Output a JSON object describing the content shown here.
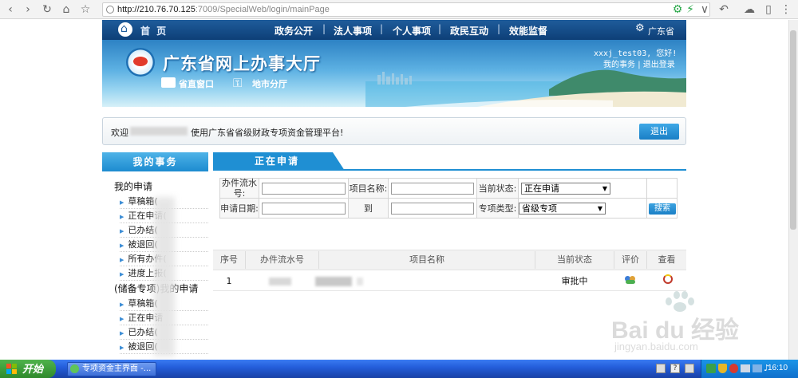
{
  "browser": {
    "url_host": "http://210.76.70.125",
    "url_path": ":7009/SpecialWeb/login/mainPage"
  },
  "nav": {
    "home": "首 页",
    "items": [
      "政务公开",
      "法人事项",
      "个人事项",
      "政民互动",
      "效能监督"
    ],
    "region": "广东省"
  },
  "banner": {
    "title": "广东省网上办事大厅",
    "link1": "省直窗口",
    "link2": "地市分厅",
    "user_greeting": "xxxj_test03, 您好!",
    "my_affairs": "我的事务",
    "logout_link": "退出登录"
  },
  "welcome": {
    "prefix": "欢迎",
    "message": "使用广东省省级财政专项资金管理平台!",
    "exit_button": "退出"
  },
  "sidebar": {
    "title": "我的事务",
    "group1": "我的申请",
    "group1_items": [
      "草稿箱(",
      "正在申请(",
      "已办结(",
      "被退回(",
      "所有办件(",
      "进度上报("
    ],
    "group2": "(储备专项)我的申请",
    "group2_items": [
      "草稿箱(",
      "正在申请",
      "已办结(",
      "被退回("
    ]
  },
  "main": {
    "tab": "正在申请",
    "form": {
      "flow_no_label": "办件流水号:",
      "project_name_label": "项目名称:",
      "status_label": "当前状态:",
      "status_value": "正在申请",
      "date_label": "申请日期:",
      "to_label": "到",
      "type_label": "专项类型:",
      "type_value": "省级专项",
      "search_button": "搜索"
    },
    "table": {
      "headers": [
        "序号",
        "办件流水号",
        "项目名称",
        "当前状态",
        "评价",
        "查看"
      ],
      "rows": [
        {
          "index": "1",
          "status": "审批中"
        }
      ]
    }
  },
  "taskbar": {
    "start": "开始",
    "task": "专项资金主界面 -...",
    "clock": "16:10"
  },
  "watermark": {
    "brand": "Bai du 经验",
    "site": "jingyan.baidu.com"
  }
}
